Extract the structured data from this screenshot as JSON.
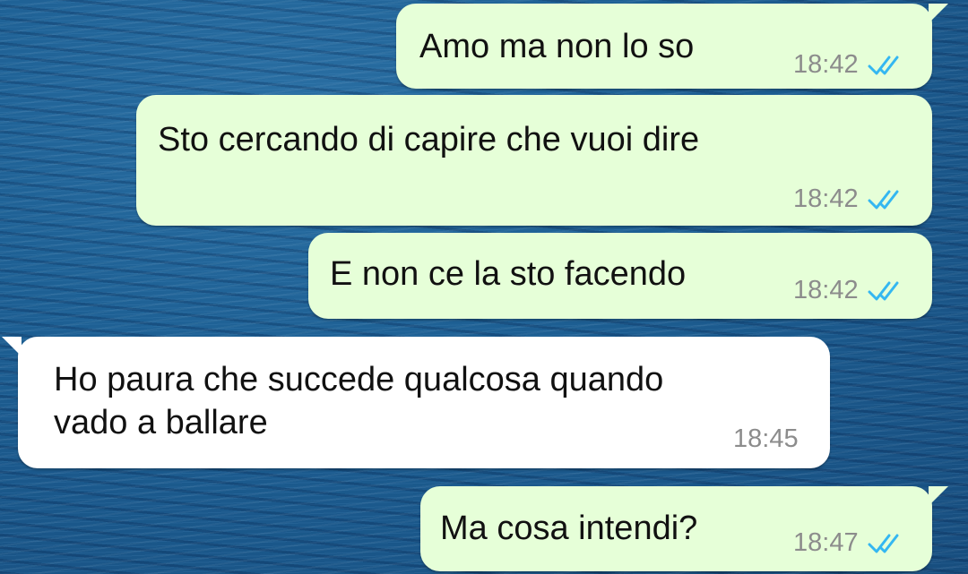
{
  "conversation": {
    "messages": [
      {
        "direction": "outgoing",
        "text": "Amo ma non lo so",
        "time": "18:42",
        "status": "read",
        "status_icon": "double-check-icon"
      },
      {
        "direction": "outgoing",
        "text": "Sto cercando di capire che vuoi dire",
        "time": "18:42",
        "status": "read",
        "status_icon": "double-check-icon"
      },
      {
        "direction": "outgoing",
        "text": "E non ce la sto facendo",
        "time": "18:42",
        "status": "read",
        "status_icon": "double-check-icon"
      },
      {
        "direction": "incoming",
        "text": "Ho paura che succede qualcosa quando\nvado a ballare",
        "time": "18:45"
      },
      {
        "direction": "outgoing",
        "text": "Ma cosa intendi?",
        "time": "18:47",
        "status": "read",
        "status_icon": "double-check-icon"
      }
    ]
  },
  "colors": {
    "outgoing_bubble": "#e6ffd8",
    "incoming_bubble": "#ffffff",
    "read_tick": "#34b7f1",
    "timestamp": "#8c8c8c",
    "wallpaper": "#1b5a8c"
  }
}
